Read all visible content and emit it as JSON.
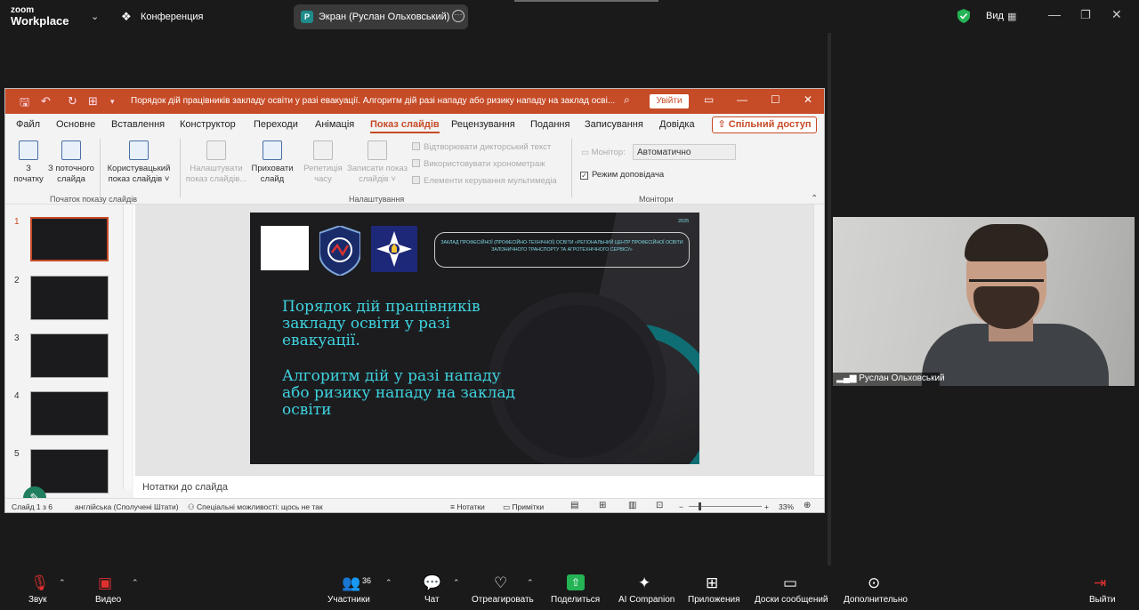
{
  "zoom": {
    "logo_small": "zoom",
    "logo_big": "Workplace",
    "meeting": "Конференция",
    "share_badge": "P",
    "share_label": "Экран (Руслан Ольховський)",
    "view_label": "Вид",
    "accent": "#24b355"
  },
  "ppt": {
    "doc_title": "Порядок дій працівників закладу освіти у разі евакуації. Алгоритм дій разі нападу або ризику нападу на заклад осві...",
    "sign_in": "Увійти",
    "share": "Спільний доступ",
    "tabs": [
      "Файл",
      "Основне",
      "Вставлення",
      "Конструктор",
      "Переходи",
      "Анімація",
      "Показ слайдів",
      "Рецензування",
      "Подання",
      "Записування",
      "Довідка"
    ],
    "ribbon": {
      "from_start_1": "З",
      "from_start_2": "початку",
      "from_current_1": "З поточного",
      "from_current_2": "слайда",
      "custom_1": "Користувацький",
      "custom_2": "показ слайдів ˅",
      "group1": "Початок показу слайдів",
      "setup_1": "Налаштувати",
      "setup_2": "показ слайдів...",
      "hide_1": "Приховати",
      "hide_2": "слайд",
      "rehearse_1": "Репетиція",
      "rehearse_2": "часу",
      "record_1": "Записати показ",
      "record_2": "слайдів ˅",
      "chk1": "Відтворювати дикторський текст",
      "chk2": "Використовувати хронометраж",
      "chk3": "Елементи керування мультимедіа",
      "group2": "Налаштування",
      "monitor_label": "Монітор:",
      "monitor_value": "Автоматично",
      "presenter": "Режим доповідача",
      "group3": "Монітори"
    },
    "thumbs": [
      "1",
      "2",
      "3",
      "4",
      "5"
    ],
    "slide": {
      "year": "2025",
      "box_text": "ЗАКЛАД ПРОФЕСІЙНОЇ (ПРОФЕСІЙНО-ТЕХНІЧНОЇ) ОСВІТИ «РЕГІОНАЛЬНИЙ ЦЕНТР ПРОФЕСІЙНОЇ ОСВІТИ ЗАЛІЗНИЧНОГО ТРАНСПОРТУ ТА АГРОТЕХНІЧНОГО СЕРВІСУ»",
      "title1": "Порядок дій працівників закладу освіти у разі евакуації.",
      "title2": " Алгоритм дій у разі нападу або ризику нападу на заклад освіти"
    },
    "notes": "Нотатки до слайда",
    "status": {
      "slide_of": "Слайд 1 з 6",
      "lang": "англійська (Сполучені Штати)",
      "access": "Спеціальні можливості: щось не так",
      "notes_btn": "Нотатки",
      "comments_btn": "Примітки",
      "zoom": "33%"
    }
  },
  "video": {
    "name": "Руслан Ольховський"
  },
  "bottom": {
    "audio": "Звук",
    "video": "Видео",
    "participants": "Участники",
    "participants_count": "36",
    "chat": "Чат",
    "react": "Отреагировать",
    "share": "Поделиться",
    "ai": "AI Companion",
    "apps": "Приложения",
    "boards": "Доски сообщений",
    "more": "Дополнительно",
    "leave": "Выйти"
  }
}
